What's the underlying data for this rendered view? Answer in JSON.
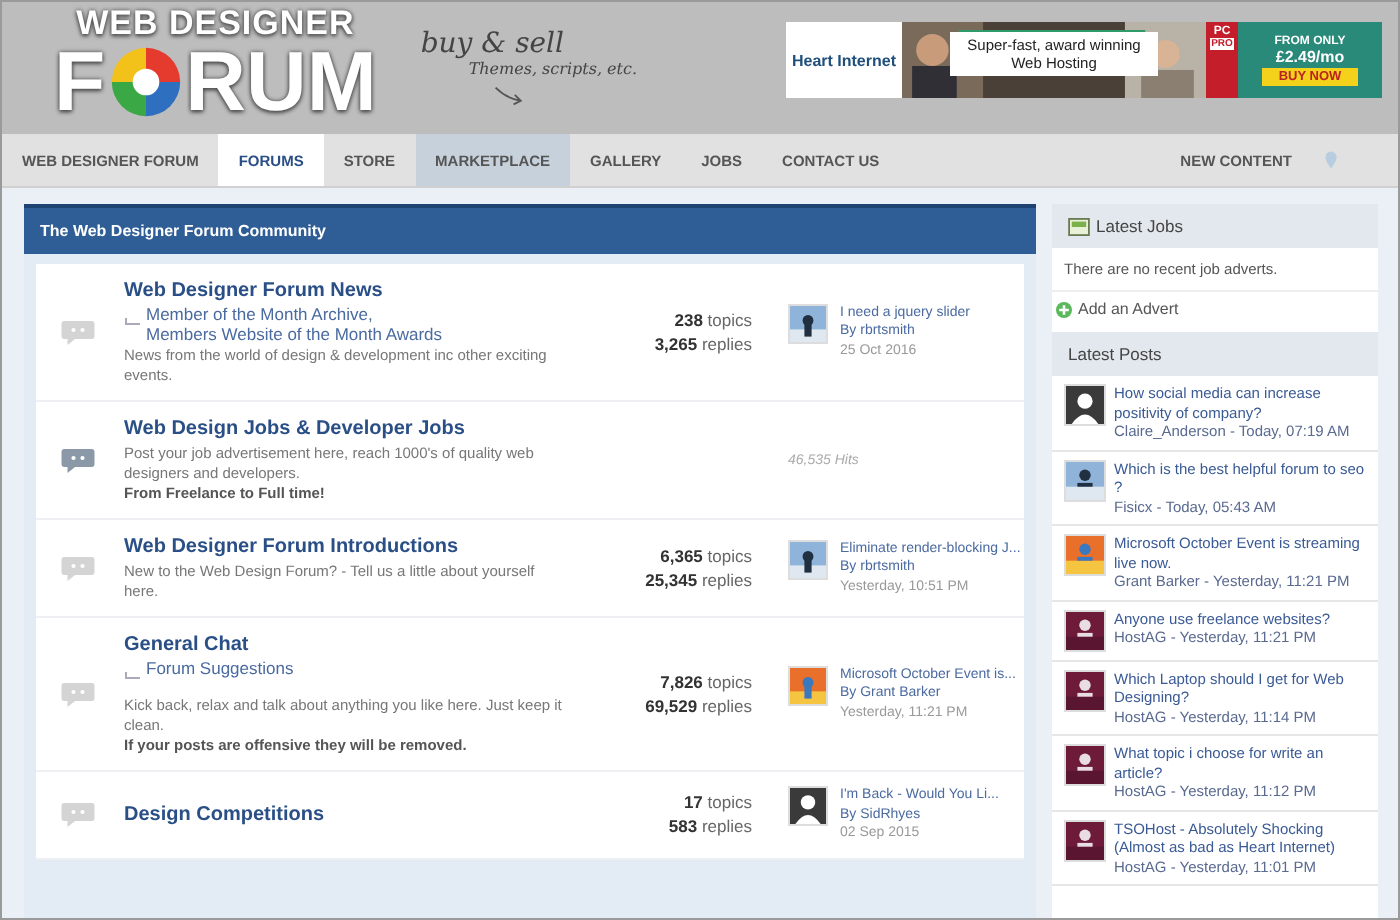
{
  "header": {
    "logo_top": "WEB DESIGNER",
    "logo_left": "F",
    "logo_right": "RUM",
    "tagline": "buy & sell",
    "tagline_sub": "Themes, scripts, etc.",
    "ad": {
      "brand": "Heart Internet",
      "headline": "Super-fast, award winning Web Hosting",
      "badge_top": "PC",
      "badge_bottom": "PRO",
      "price_label": "FROM ONLY",
      "price": "£2.49/mo",
      "cta": "BUY NOW"
    }
  },
  "nav": {
    "items": [
      {
        "label": "WEB DESIGNER FORUM",
        "selected": false,
        "highlighted": false
      },
      {
        "label": "FORUMS",
        "selected": true,
        "highlighted": false
      },
      {
        "label": "STORE",
        "selected": false,
        "highlighted": false
      },
      {
        "label": "MARKETPLACE",
        "selected": false,
        "highlighted": true
      },
      {
        "label": "GALLERY",
        "selected": false,
        "highlighted": false
      },
      {
        "label": "JOBS",
        "selected": false,
        "highlighted": false
      },
      {
        "label": "CONTACT US",
        "selected": false,
        "highlighted": false
      }
    ],
    "right": "NEW CONTENT"
  },
  "category": {
    "title": "The Web Designer Forum Community",
    "forums": [
      {
        "kind": "forum",
        "title": "Web Designer Forum News",
        "subforums": [
          "Member of the Month Archive,",
          "Members Website of the Month Awards"
        ],
        "description": "News from the world of design & development inc other exciting events.",
        "topics": "**238** topics",
        "replies": "**3,265** replies",
        "last_post": {
          "title": "I need a jquery slider",
          "by": "By rbrtsmith",
          "date": "25 Oct 2016",
          "default_avatar": false
        }
      },
      {
        "kind": "link",
        "title": "Web Design Jobs & Developer Jobs",
        "description": "Post your job advertisement here, reach 1000's of quality web designers and developers.",
        "note": "From Freelance to Full time!",
        "hits": "46,535 Hits"
      },
      {
        "kind": "forum",
        "title": "Web Designer Forum Introductions",
        "description": "New to the Web Design Forum? - Tell us a little about yourself here.",
        "topics": "**6,365** topics",
        "replies": "**25,345** replies",
        "last_post": {
          "title": "Eliminate render-blocking J...",
          "by": "By rbrtsmith",
          "date": "Yesterday, 10:51 PM",
          "default_avatar": false
        }
      },
      {
        "kind": "forum",
        "title": "General Chat",
        "subforums": [
          "Forum Suggestions"
        ],
        "description": "Kick back, relax and talk about anything you like here. Just keep it clean.",
        "note": "If your posts are offensive they will be removed.",
        "topics": "**7,826** topics",
        "replies": "**69,529** replies",
        "last_post": {
          "title": "Microsoft October Event is...",
          "by": "By Grant Barker",
          "date": "Yesterday, 11:21 PM",
          "default_avatar": false
        }
      },
      {
        "kind": "forum",
        "title": "Design Competitions",
        "topics": "**17** topics",
        "replies": "**583** replies",
        "last_post": {
          "title": "I'm Back - Would You Li...",
          "by": "By SidRhyes",
          "date": "02 Sep 2015",
          "default_avatar": true
        }
      }
    ]
  },
  "sidebar": {
    "jobs_title": "Latest Jobs",
    "jobs_empty": "There are no recent job adverts.",
    "add_advert": "Add an Advert",
    "posts_title": "Latest Posts",
    "posts": [
      {
        "title": "How social media can increase positivity of company?",
        "meta": "Claire_Anderson - Today, 07:19 AM",
        "default_avatar": true
      },
      {
        "title": "Which is the best helpful forum to seo ?",
        "meta": "Fisicx - Today, 05:43 AM",
        "default_avatar": false
      },
      {
        "title": "Microsoft October Event is streaming live now.",
        "meta": "Grant Barker - Yesterday, 11:21 PM",
        "default_avatar": false
      },
      {
        "title": "Anyone use freelance websites?",
        "meta": "HostAG - Yesterday, 11:21 PM",
        "default_avatar": false
      },
      {
        "title": "Which Laptop should I get for Web Designing?",
        "meta": "HostAG - Yesterday, 11:14 PM",
        "default_avatar": false
      },
      {
        "title": "What topic i choose for write an article?",
        "meta": "HostAG - Yesterday, 11:12 PM",
        "default_avatar": false
      },
      {
        "title": "TSOHost - Absolutely Shocking (Almost as bad as Heart Internet)",
        "meta": "HostAG - Yesterday, 11:01 PM",
        "default_avatar": false
      }
    ]
  }
}
